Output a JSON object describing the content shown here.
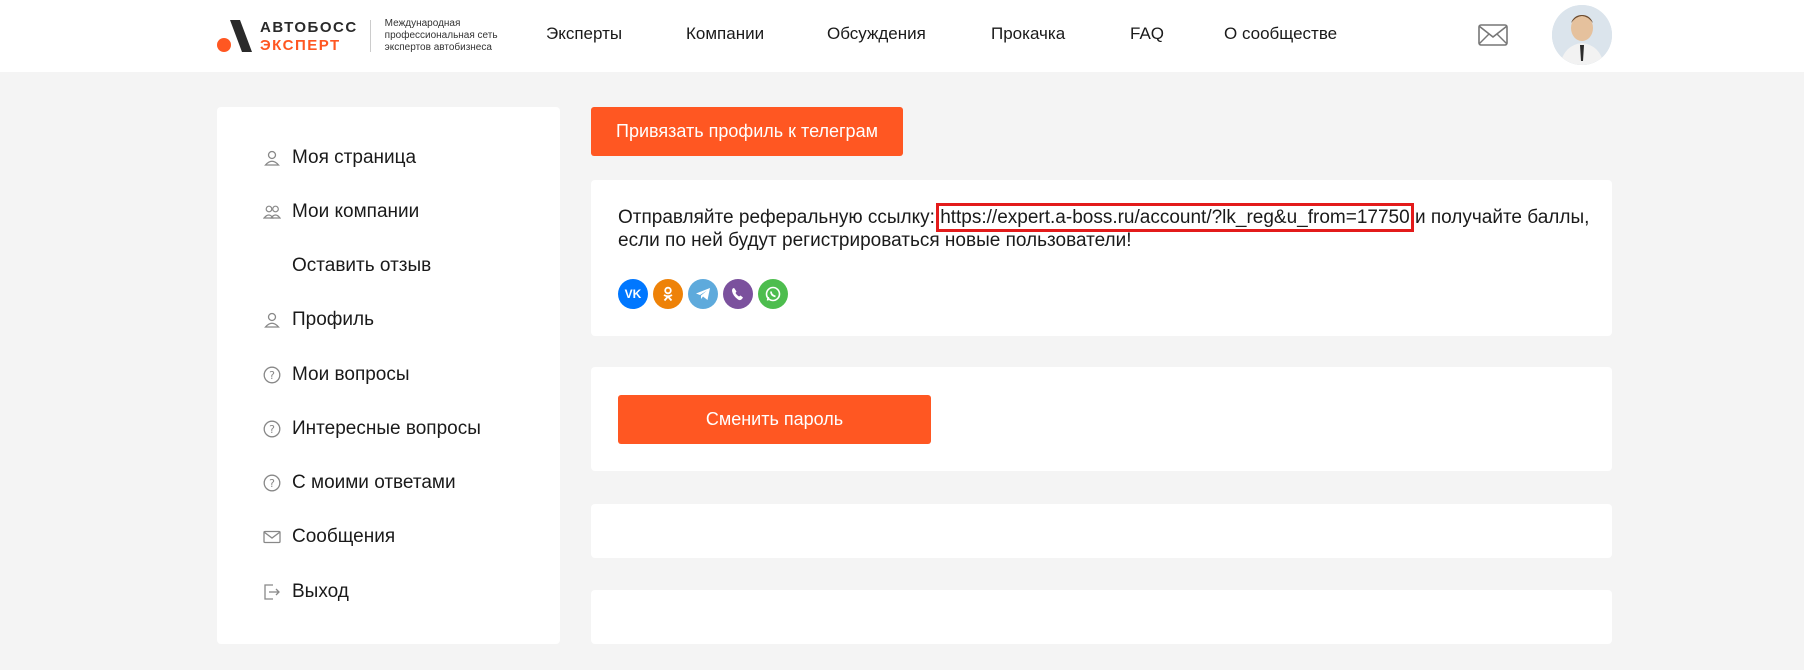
{
  "logo": {
    "word1": "АВТОБОСС",
    "word2": "ЭКСПЕРТ",
    "tagline": "Международная профессиональная сеть экспертов автобизнеса"
  },
  "nav": {
    "items": [
      {
        "label": "Эксперты"
      },
      {
        "label": "Компании"
      },
      {
        "label": "Обсуждения"
      },
      {
        "label": "Прокачка"
      },
      {
        "label": "FAQ"
      },
      {
        "label": "О сообществе"
      }
    ]
  },
  "sidebar": {
    "items": [
      {
        "label": "Моя страница",
        "icon": "user-icon"
      },
      {
        "label": "Мои компании",
        "icon": "users-icon"
      },
      {
        "label": "Оставить отзыв",
        "icon": ""
      },
      {
        "label": "Профиль",
        "icon": "user-icon"
      },
      {
        "label": "Мои вопросы",
        "icon": "question-circle-icon"
      },
      {
        "label": "Интересные вопросы",
        "icon": "question-circle-icon"
      },
      {
        "label": "С моими ответами",
        "icon": "question-circle-icon"
      },
      {
        "label": "Сообщения",
        "icon": "envelope-icon"
      },
      {
        "label": "Выход",
        "icon": "logout-icon"
      }
    ]
  },
  "main": {
    "telegram_button": "Привязать профиль к телеграм",
    "referral": {
      "before": "Отправляйте реферальную ссылку: ",
      "link": "https://expert.a-boss.ru/account/?lk_reg&u_from=17750",
      "after": " и получайте баллы, если по ней будут регистрироваться новые пользователи!"
    },
    "share_buttons": [
      {
        "name": "vk",
        "label": "VK",
        "color": "#0077ff"
      },
      {
        "name": "odnoklassniki",
        "label": "OK",
        "color": "#ee8208"
      },
      {
        "name": "telegram",
        "label": "",
        "color": "#5eaadc"
      },
      {
        "name": "viber",
        "label": "",
        "color": "#7b519d"
      },
      {
        "name": "whatsapp",
        "label": "",
        "color": "#4dbd4e"
      }
    ],
    "change_password_button": "Сменить пароль"
  },
  "colors": {
    "accent": "#ff5722",
    "highlight_box": "#e31b1b",
    "background": "#f4f4f4"
  }
}
